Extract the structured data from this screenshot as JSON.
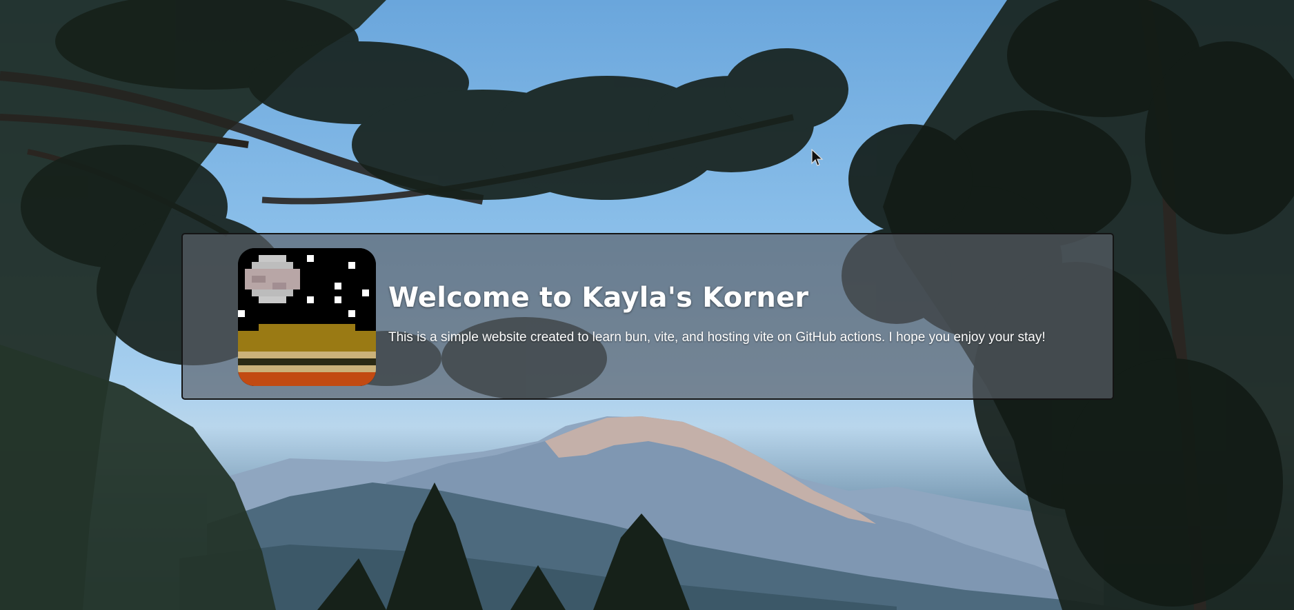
{
  "banner": {
    "title": "Welcome to Kayla's Korner",
    "subtitle": "This is a simple website created to learn bun, vite, and hosting vite on GitHub actions. I hope you enjoy your stay!"
  },
  "logo": {
    "icon": "pixel-art-moon-night-landscape-icon"
  },
  "background": {
    "description_icon": "pine-trees-mountain-photo",
    "sky_color": "#8cc0ea"
  },
  "colors": {
    "banner_bg": "#5a6068",
    "banner_border": "#141414",
    "text": "#ffffff",
    "logo_gold": "#9a7a14",
    "logo_tan": "#cbb27a",
    "logo_dark": "#2b2a14",
    "logo_orange": "#c24a12"
  }
}
